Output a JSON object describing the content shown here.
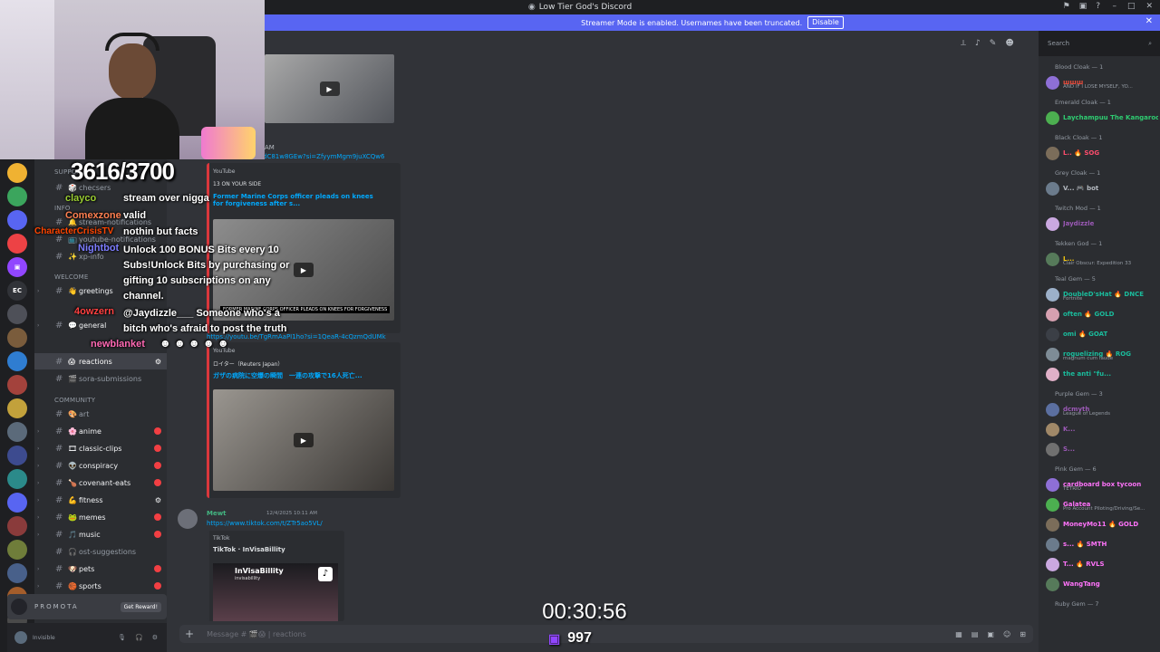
{
  "window": {
    "title": "Low Tier God's Discord",
    "banner_text": "Streamer Mode is enabled. Usernames have been truncated.",
    "banner_button": "Disable"
  },
  "search": {
    "placeholder": "Search"
  },
  "stream_overlay": {
    "goal": "3616/3700",
    "timer": "00:30:56",
    "viewers": "997",
    "chat": [
      {
        "user": "clayco",
        "color": "#9acd32",
        "message": "stream over nigga"
      },
      {
        "user": "Comexzone",
        "color": "#ff7f50",
        "message": "valid"
      },
      {
        "user": "CharacterCrisisTV",
        "color": "#ff4500",
        "message": "nothin but facts"
      },
      {
        "user": "Nightbot",
        "color": "#7c7cff",
        "message": "Unlock 100 BONUS Bits every 10 Subs!Unlock Bits by purchasing or gifting 10 subscriptions on any channel."
      },
      {
        "user": "4owzern",
        "color": "#ff4040",
        "message": "@Jaydizzle___ Someone who's a bitch who's afraid to post the truth"
      },
      {
        "user": "newblanket",
        "color": "#ff69b4",
        "message": ""
      }
    ]
  },
  "channels": {
    "categories": [
      "SUPPORT",
      "INFO",
      "WELCOME",
      "COMMUNITY"
    ],
    "items": [
      {
        "label": "checsers",
        "emoji": "🎲"
      },
      {
        "label": "stream-notifications",
        "emoji": "🔔"
      },
      {
        "label": "youtube-notifications",
        "emoji": "📺"
      },
      {
        "label": "xp-info",
        "emoji": "✨"
      },
      {
        "label": "greetings",
        "emoji": "👋"
      },
      {
        "label": "general",
        "emoji": "💬"
      },
      {
        "label": "reactions",
        "emoji": "😱"
      },
      {
        "label": "sora-submissions",
        "emoji": "🎬"
      },
      {
        "label": "art",
        "emoji": "🎨"
      },
      {
        "label": "anime",
        "emoji": "🌸"
      },
      {
        "label": "classic-clips",
        "emoji": "🎞"
      },
      {
        "label": "conspiracy",
        "emoji": "👽"
      },
      {
        "label": "covenant-eats",
        "emoji": "🍗"
      },
      {
        "label": "fitness",
        "emoji": "💪"
      },
      {
        "label": "memes",
        "emoji": "🐸"
      },
      {
        "label": "music",
        "emoji": "🎵"
      },
      {
        "label": "ost-suggestions",
        "emoji": "🎧"
      },
      {
        "label": "pets",
        "emoji": "🐶"
      },
      {
        "label": "sports",
        "emoji": "🏀"
      }
    ],
    "promo_button": "Get Reward!",
    "promo_label": "PROMOTA",
    "user_status": "Invisible"
  },
  "messages": {
    "link1": "dC81w8GEw?si=ZfyymMgm9juXCQw6",
    "embed1": {
      "provider": "YouTube",
      "author": "13 ON YOUR SIDE",
      "title": "Former Marine Corps officer pleads on knees for forgiveness after s...",
      "caption": "FORMER MARINE CORPS OFFICER PLEADS ON KNEES FOR FORGIVENESS"
    },
    "link2": "https://youtu.be/TgRmAaPI1ho?si=1QeaR-4cQzmQdUMk",
    "embed2": {
      "provider": "YouTube",
      "author": "ロイター（Reuters Japan）",
      "title": "ガザの病院に空爆の瞬間　一連の攻撃で16人死亡..."
    },
    "msg3": {
      "author": "Mewt",
      "timestamp": "12/4/2025 10:11 AM",
      "link": "https://www.tiktok.com/t/ZTr5ao5VL/"
    },
    "embed3": {
      "provider": "TikTok",
      "title": "TikTok · InVisaBillity",
      "account": "InVisaBillity",
      "handle": "invisabillity"
    },
    "am": "AM"
  },
  "composer": {
    "placeholder": "Message # 🎬😱 | reactions"
  },
  "members": {
    "groups": [
      {
        "name": "Blood Cloak — 1",
        "members": [
          {
            "name": "ꟺꟺꟺ",
            "sub": "AND IF I LOSE MYSELF, YO...",
            "color": "#e74c3c"
          }
        ]
      },
      {
        "name": "Emerald Cloak — 1",
        "members": [
          {
            "name": "Laychampuu The Kangaroo",
            "sub": "",
            "color": "#2ecc71"
          }
        ]
      },
      {
        "name": "Black Cloak — 1",
        "members": [
          {
            "name": "L.. 🔥 SOG",
            "sub": "",
            "color": "#ff4d6d"
          }
        ]
      },
      {
        "name": "Grey Cloak — 1",
        "members": [
          {
            "name": "V... 🎮 bot",
            "sub": "",
            "color": "#b5bac1"
          }
        ]
      },
      {
        "name": "Twitch Mod — 1",
        "members": [
          {
            "name": "Jaydizzle",
            "sub": "",
            "color": "#9b59b6"
          }
        ]
      },
      {
        "name": "Tekken God — 1",
        "members": [
          {
            "name": "L...",
            "sub": "Clair Obscur: Expedition 33",
            "color": "#f1c40f"
          }
        ]
      },
      {
        "name": "Teal Gem — 5",
        "members": [
          {
            "name": "DoubleD'sHat 🔥 DNCE",
            "sub": "Fortnite",
            "color": "#1abc9c"
          },
          {
            "name": "often 🔥 GOLD",
            "sub": "",
            "color": "#1abc9c"
          },
          {
            "name": "omi 🔥 GOAT",
            "sub": "",
            "color": "#1abc9c"
          },
          {
            "name": "roguelizing 🔥 ROG",
            "sub": "magnum cum laude",
            "color": "#1abc9c"
          },
          {
            "name": "the anti \"fu...",
            "sub": "",
            "color": "#1abc9c"
          }
        ]
      },
      {
        "name": "Purple Gem — 3",
        "members": [
          {
            "name": "dcmyth",
            "sub": "League of Legends",
            "color": "#9b59b6"
          },
          {
            "name": "K...",
            "sub": "",
            "color": "#9b59b6"
          },
          {
            "name": "S...",
            "sub": "",
            "color": "#9b59b6"
          }
        ]
      },
      {
        "name": "Pink Gem — 6",
        "members": [
          {
            "name": "cardboard box tycoon",
            "sub": "TETRIO",
            "color": "#ff73fa"
          },
          {
            "name": "Galatea",
            "sub": "Pro Account Piloting/Driving/Se...",
            "color": "#ff73fa"
          },
          {
            "name": "MoneyMo11 🔥 GOLD",
            "sub": "",
            "color": "#ff73fa"
          },
          {
            "name": "s... 🔥 SMTH",
            "sub": "",
            "color": "#ff73fa"
          },
          {
            "name": "T... 🔥 RVLS",
            "sub": "",
            "color": "#ff73fa"
          },
          {
            "name": "WangTang",
            "sub": "",
            "color": "#ff73fa"
          }
        ]
      },
      {
        "name": "Ruby Gem — 7",
        "members": []
      }
    ]
  },
  "colors": {
    "accent": "#5865f2",
    "bg_main": "#313338",
    "bg_side": "#2b2d31",
    "bg_rail": "#1e1f22",
    "link": "#00a8fc",
    "embed_border": "#da373c"
  }
}
